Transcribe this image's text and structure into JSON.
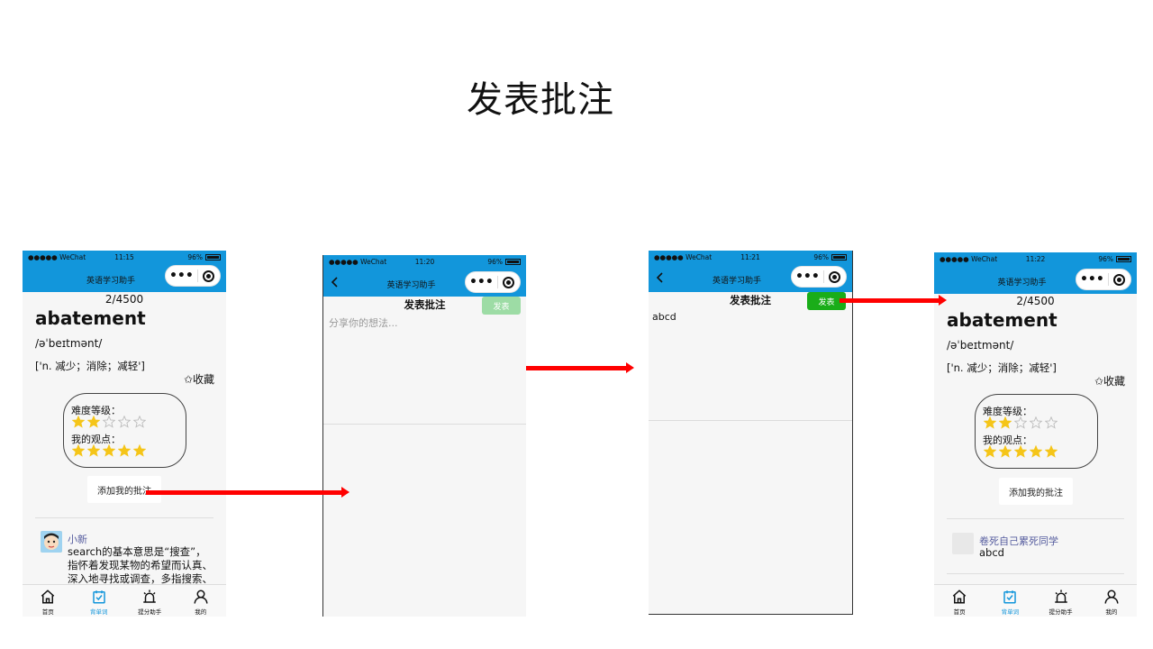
{
  "slide": {
    "title": "发表批注"
  },
  "app": {
    "name": "英语学习助手",
    "carrier": "●●●●● WeChat",
    "battery": "96%",
    "accent": "#1296db",
    "publish_green": "#1aad19",
    "publish_disabled": "#9ddca5"
  },
  "screen1": {
    "time": "11:15",
    "counter": "2/4500",
    "word": "abatement",
    "phonetic": "/əˈbeɪtmənt/",
    "meaning": "['n. 减少；消除；减轻']",
    "favorite": "✩收藏",
    "difficulty_label": "难度等级：",
    "difficulty_value": 2,
    "opinion_label": "我的观点：",
    "opinion_value": 5,
    "add_note": "添加我的批注",
    "comment": {
      "user": "小新",
      "lines": [
        "search的基本意思是“搜查”，",
        "指怀着发现某物的希望而认真、",
        "深入地寻找或调查，多指搜索、"
      ]
    }
  },
  "screen2": {
    "time": "11:20",
    "page_title": "发表批注",
    "publish": "发表",
    "placeholder": "分享你的想法..."
  },
  "screen3": {
    "time": "11:21",
    "page_title": "发表批注",
    "publish": "发表",
    "value": "abcd"
  },
  "screen4": {
    "time": "11:22",
    "counter": "2/4500",
    "word": "abatement",
    "phonetic": "/əˈbeɪtmənt/",
    "meaning": "['n. 减少；消除；减轻']",
    "favorite": "✩收藏",
    "difficulty_label": "难度等级：",
    "difficulty_value": 2,
    "opinion_label": "我的观点：",
    "opinion_value": 5,
    "add_note": "添加我的批注",
    "comment": {
      "user": "卷死自己累死同学",
      "text": "abcd"
    }
  },
  "tabbar": [
    {
      "label": "首页",
      "icon": "home-icon"
    },
    {
      "label": "背单词",
      "icon": "checklist-icon"
    },
    {
      "label": "提分助手",
      "icon": "alarm-icon"
    },
    {
      "label": "我的",
      "icon": "user-icon"
    }
  ]
}
